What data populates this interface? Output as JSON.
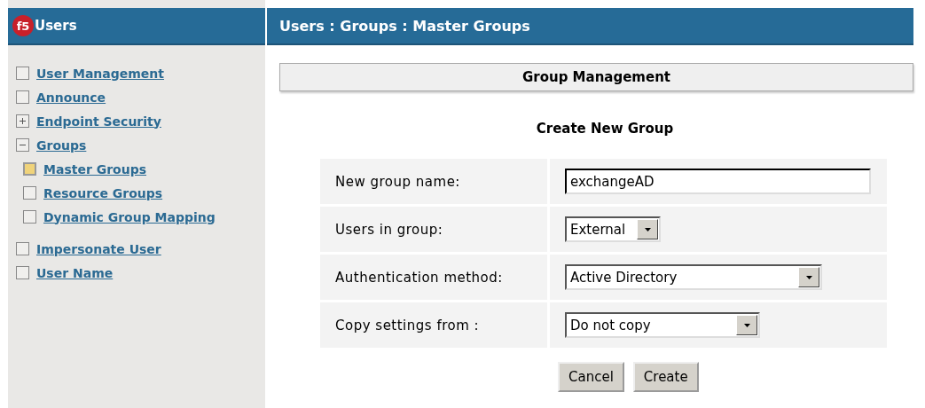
{
  "sidebar": {
    "logo_text": "f5",
    "title": "Users",
    "items": [
      {
        "label": "User Management",
        "kind": "box",
        "selected": false
      },
      {
        "label": "Announce",
        "kind": "box",
        "selected": false
      },
      {
        "label": "Endpoint Security",
        "kind": "collapsed",
        "selected": false
      },
      {
        "label": "Groups",
        "kind": "expanded",
        "selected": false,
        "children": [
          {
            "label": "Master Groups",
            "selected": true
          },
          {
            "label": "Resource Groups",
            "selected": false
          },
          {
            "label": "Dynamic Group Mapping",
            "selected": false
          }
        ]
      },
      {
        "label": "Impersonate User",
        "kind": "box",
        "selected": false
      },
      {
        "label": "User Name",
        "kind": "box",
        "selected": false
      }
    ]
  },
  "breadcrumb": "Users : Groups : Master Groups",
  "section_title": "Group Management",
  "form": {
    "title": "Create New Group",
    "rows": [
      {
        "label": "New group name:",
        "kind": "text",
        "value": "exchangeAD"
      },
      {
        "label": "Users in group:",
        "kind": "select",
        "value": "External"
      },
      {
        "label": "Authentication method:",
        "kind": "select",
        "value": "Active Directory"
      },
      {
        "label": "Copy settings from :",
        "kind": "select",
        "value": "Do not copy"
      }
    ],
    "buttons": [
      "Cancel",
      "Create"
    ]
  }
}
